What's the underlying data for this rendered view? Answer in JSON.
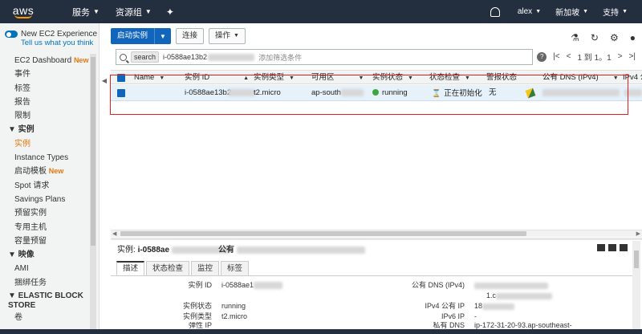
{
  "nav": {
    "logo": "aws",
    "services": "服务",
    "resource_groups": "资源组",
    "user": "alex",
    "region": "新加坡",
    "support": "支持"
  },
  "sidebar": {
    "new_exp_title": "New EC2 Experience",
    "new_exp_link": "Tell us what you think",
    "items": [
      {
        "label": "EC2 Dashboard",
        "badge": "New"
      },
      {
        "label": "事件"
      },
      {
        "label": "标签"
      },
      {
        "label": "报告"
      },
      {
        "label": "限制"
      },
      {
        "label": "▼ 实例",
        "section": true
      },
      {
        "label": "实例",
        "active": true
      },
      {
        "label": "Instance Types"
      },
      {
        "label": "启动模板",
        "badge": "New"
      },
      {
        "label": "Spot 请求"
      },
      {
        "label": "Savings Plans"
      },
      {
        "label": "预留实例"
      },
      {
        "label": "专用主机"
      },
      {
        "label": "容量预留"
      },
      {
        "label": "▼ 映像",
        "section": true
      },
      {
        "label": "AMI"
      },
      {
        "label": "捆绑任务"
      },
      {
        "label": "▼ ELASTIC BLOCK STORE",
        "section": true,
        "multi": true
      },
      {
        "label": "卷"
      }
    ]
  },
  "toolbar": {
    "launch": "启动实例",
    "connect": "连接",
    "actions": "操作"
  },
  "search": {
    "tag": "search",
    "value": "i-0588ae13b2",
    "placeholder": "添加筛选条件"
  },
  "pager": {
    "text": "1 到 1。1"
  },
  "table": {
    "columns": [
      "Name",
      "实例 ID",
      "实例类型",
      "可用区",
      "实例状态",
      "状态检查",
      "警报状态",
      "公有 DNS (IPv4)",
      "IPv4 公"
    ],
    "row": {
      "name": "",
      "instance_id": "i-0588ae13b2",
      "type": "t2.micro",
      "az": "ap-south",
      "state": "running",
      "check": "正在初始化",
      "alarm": "无"
    }
  },
  "details": {
    "title_label": "实例:",
    "title_value": "i-0588ae",
    "title2": "公有",
    "tabs": [
      "描述",
      "状态检查",
      "监控",
      "标签"
    ],
    "left": [
      {
        "k": "实例 ID",
        "v": "i-0588ae1"
      },
      {
        "k": "实例状态",
        "v": "running"
      },
      {
        "k": "实例类型",
        "v": "t2.micro"
      },
      {
        "k": "弹性 IP",
        "v": ""
      }
    ],
    "right": [
      {
        "k": "公有 DNS (IPv4)",
        "v": ""
      },
      {
        "k": "",
        "v": "1.c"
      },
      {
        "k": "IPv4 公有 IP",
        "v": "18"
      },
      {
        "k": "IPv6 IP",
        "v": "-"
      },
      {
        "k": "私有 DNS",
        "v": "ip-172-31-20-93.ap-southeast-"
      }
    ]
  },
  "colors": {
    "nav_bg": "#232f3e",
    "accent_orange": "#e47911",
    "primary_blue": "#1166bb",
    "selected_row": "#e6f1fa",
    "highlight_red": "#e02020",
    "running_green": "#3ea63e"
  }
}
